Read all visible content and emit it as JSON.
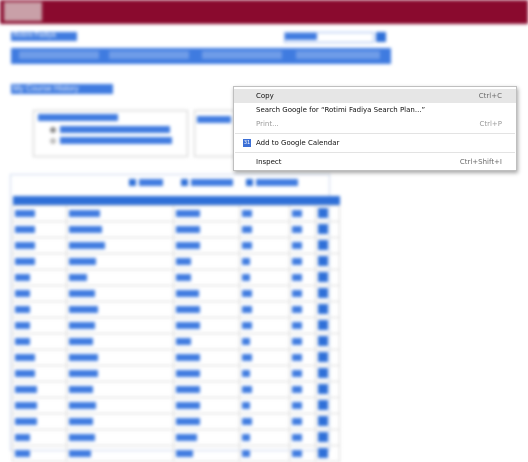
{
  "page": {
    "name": "Rotimi Fadiya",
    "section_title": "My Course History"
  },
  "context_menu": {
    "items": [
      {
        "label": "Copy",
        "shortcut": "Ctrl+C"
      },
      {
        "label": "Search Google for “Rotimi Fadiya     Search   Plan...”",
        "shortcut": ""
      },
      {
        "label": "Print...",
        "shortcut": "Ctrl+P"
      },
      {
        "label": "Add to Google Calendar",
        "shortcut": ""
      },
      {
        "label": "Inspect",
        "shortcut": "Ctrl+Shift+I"
      }
    ],
    "calendar_icon_text": "31"
  }
}
